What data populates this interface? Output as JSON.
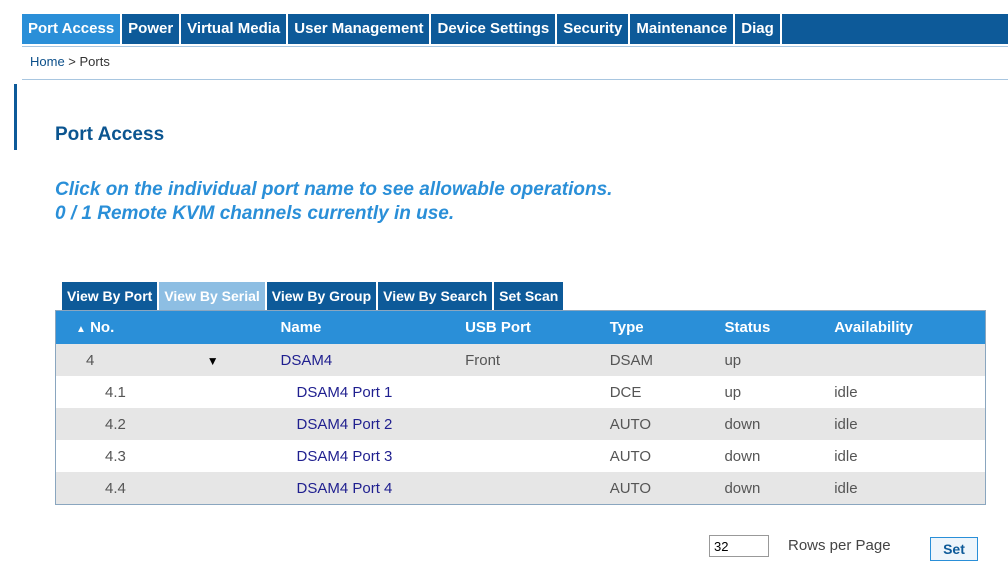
{
  "nav": {
    "tabs": [
      {
        "label": "Port Access"
      },
      {
        "label": "Power"
      },
      {
        "label": "Virtual Media"
      },
      {
        "label": "User Management"
      },
      {
        "label": "Device Settings"
      },
      {
        "label": "Security"
      },
      {
        "label": "Maintenance"
      },
      {
        "label": "Diag"
      }
    ]
  },
  "breadcrumb": {
    "home": "Home",
    "sep": " > ",
    "current": "Ports"
  },
  "page": {
    "title": "Port Access",
    "info_line1": "Click on the individual port name to see allowable operations.",
    "info_line2": "0 / 1 Remote KVM channels currently in use."
  },
  "subtabs": [
    {
      "label": "View By Port"
    },
    {
      "label": "View By Serial"
    },
    {
      "label": "View By Group"
    },
    {
      "label": "View By Search"
    },
    {
      "label": "Set Scan"
    }
  ],
  "table": {
    "headers": {
      "sort_icon": "▲",
      "no": "No.",
      "name": "Name",
      "usb": "USB Port",
      "type": "Type",
      "status": "Status",
      "availability": "Availability"
    },
    "rows": [
      {
        "no": "4",
        "toggle": "▼",
        "name": "DSAM4",
        "usb": "Front",
        "type": "DSAM",
        "status": "up",
        "availability": ""
      },
      {
        "no": "4.1",
        "toggle": "",
        "name": "DSAM4 Port 1",
        "usb": "",
        "type": "DCE",
        "status": "up",
        "availability": "idle"
      },
      {
        "no": "4.2",
        "toggle": "",
        "name": "DSAM4 Port 2",
        "usb": "",
        "type": "AUTO",
        "status": "down",
        "availability": "idle"
      },
      {
        "no": "4.3",
        "toggle": "",
        "name": "DSAM4 Port 3",
        "usb": "",
        "type": "AUTO",
        "status": "down",
        "availability": "idle"
      },
      {
        "no": "4.4",
        "toggle": "",
        "name": "DSAM4 Port 4",
        "usb": "",
        "type": "AUTO",
        "status": "down",
        "availability": "idle"
      }
    ]
  },
  "footer": {
    "rows_value": "32",
    "rows_label": "Rows per Page",
    "set_label": "Set"
  },
  "colors": {
    "nav_bg": "#0d5a99",
    "accent": "#2a8fd8",
    "active_subtab": "#8dbee3"
  }
}
